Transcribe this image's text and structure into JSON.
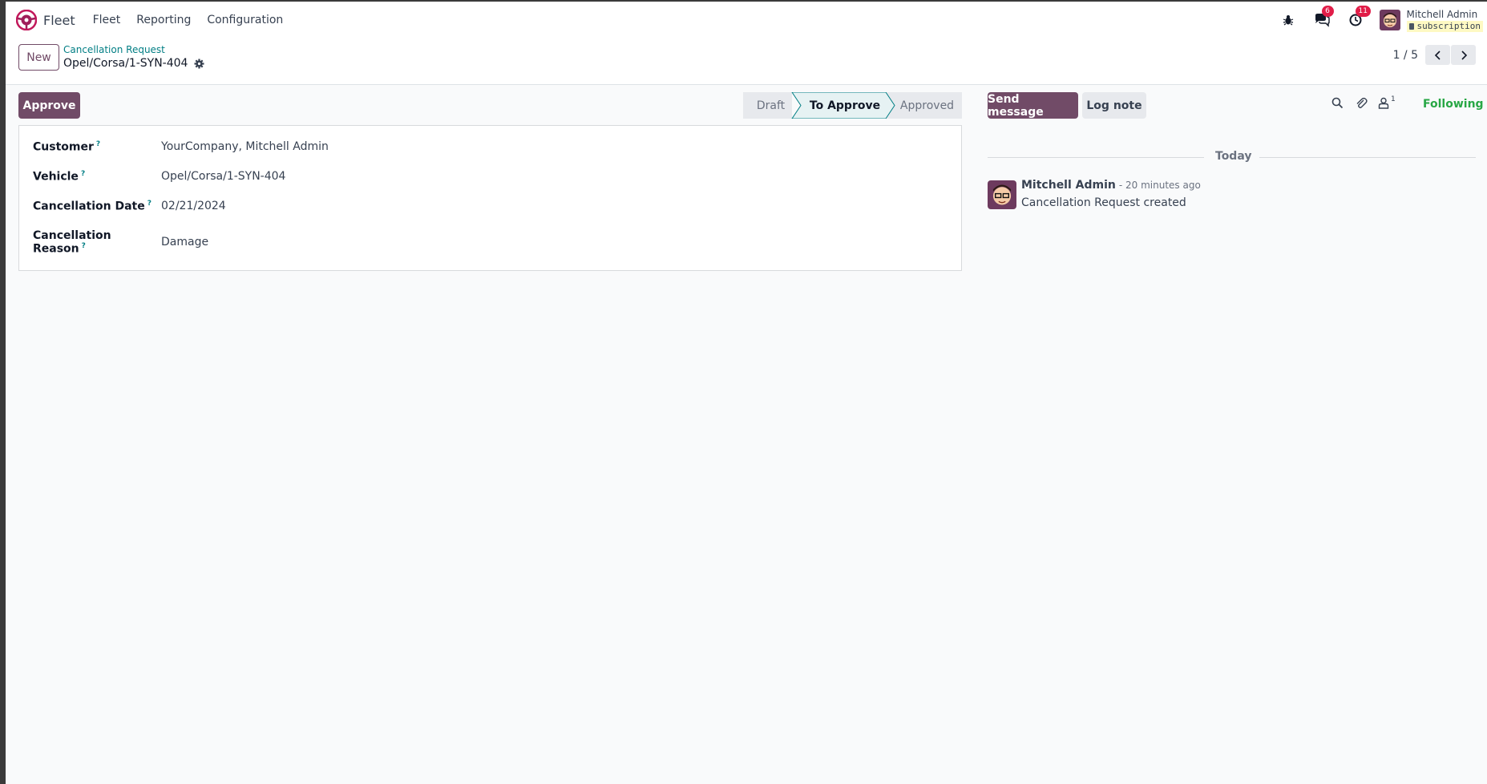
{
  "navbar": {
    "app_name": "Fleet",
    "menu": [
      "Fleet",
      "Reporting",
      "Configuration"
    ],
    "messages_badge": "6",
    "activities_badge": "11",
    "user_name": "Mitchell Admin",
    "database": "subscription"
  },
  "control_panel": {
    "new_label": "New",
    "breadcrumb": "Cancellation Request",
    "record_name": "Opel/Corsa/1-SYN-404",
    "pager": "1 / 5"
  },
  "form": {
    "approve_label": "Approve",
    "status_steps": [
      {
        "label": "Draft",
        "state": "inactive"
      },
      {
        "label": "To Approve",
        "state": "current"
      },
      {
        "label": "Approved",
        "state": "inactive"
      }
    ],
    "fields": [
      {
        "label": "Customer",
        "help": "?",
        "value": "YourCompany, Mitchell Admin"
      },
      {
        "label": "Vehicle",
        "help": "?",
        "value": "Opel/Corsa/1-SYN-404"
      },
      {
        "label": "Cancellation Date",
        "help": "?",
        "value": "02/21/2024"
      },
      {
        "label": "Cancellation Reason",
        "help": "?",
        "value": "Damage"
      }
    ]
  },
  "chatter": {
    "send_message_label": "Send message",
    "log_note_label": "Log note",
    "followers_count": "1",
    "following_label": "Following",
    "date_separator": "Today",
    "messages": [
      {
        "author": "Mitchell Admin",
        "time": "- 20 minutes ago",
        "body": "Cancellation Request created"
      }
    ]
  },
  "colors": {
    "brand": "#714b67",
    "link": "#017e84",
    "following": "#28a745",
    "badge": "#e11d48",
    "status_current_bg": "#e6f2f3",
    "status_inactive_bg": "#e7e9ed"
  },
  "icons": {
    "app": "fleet-logo-icon",
    "debug": "bug-icon",
    "messages": "chat-bubbles-icon",
    "activities": "clock-icon",
    "settings": "gear-icon",
    "prev": "chevron-left-icon",
    "next": "chevron-right-icon",
    "search": "search-icon",
    "attachments": "paperclip-icon",
    "followers": "user-icon"
  }
}
